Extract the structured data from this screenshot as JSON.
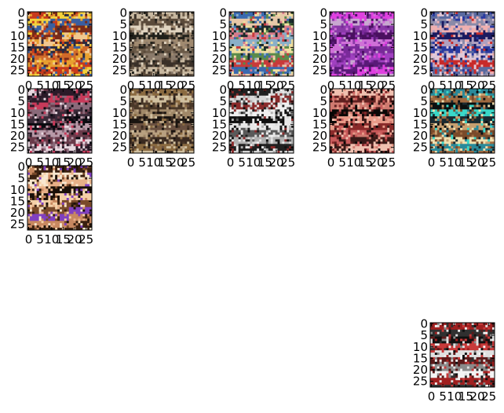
{
  "figure": {
    "panel_count": 12,
    "image_size": [
      28,
      28
    ],
    "axis": {
      "y_ticks": [
        "0",
        "5",
        "10",
        "15",
        "20",
        "25"
      ],
      "x_ticks": [
        "0",
        "5",
        "10",
        "15",
        "20",
        "25"
      ]
    },
    "panels": [
      {
        "name": "thumbnail-1",
        "palette": [
          "#e8a030",
          "#c83a1c",
          "#f4d23a",
          "#3a5fa0",
          "#7a2a18",
          "#f0c890",
          "#2a2a40",
          "#d06a2a"
        ]
      },
      {
        "name": "thumbnail-2",
        "palette": [
          "#8a7a6a",
          "#3a3028",
          "#c8b8a0",
          "#5a4a3a",
          "#e0d4c0",
          "#20201a",
          "#a08a70",
          "#6a5a48"
        ]
      },
      {
        "name": "thumbnail-3",
        "palette": [
          "#5a8a4a",
          "#c83a3a",
          "#3a6ab0",
          "#e8c8a8",
          "#1a2a2a",
          "#d87a8a",
          "#8ab0c8",
          "#f0e0a0"
        ]
      },
      {
        "name": "thumbnail-4",
        "palette": [
          "#7a2a9a",
          "#a040c0",
          "#5a1a78",
          "#e040e0",
          "#c8a8d0",
          "#8a3aa8",
          "#4a1060",
          "#d070d8"
        ]
      },
      {
        "name": "thumbnail-5",
        "palette": [
          "#2a3aa0",
          "#e0c8d8",
          "#c82a2a",
          "#5a6aa0",
          "#8a8aa8",
          "#f0b0b0",
          "#1a1a60",
          "#b0a0c0"
        ]
      },
      {
        "name": "thumbnail-6",
        "palette": [
          "#0a0a10",
          "#b89aa8",
          "#6a3a4a",
          "#e8d8e0",
          "#2a1a28",
          "#c83a5a",
          "#8a6a7a",
          "#3a2a38"
        ]
      },
      {
        "name": "thumbnail-7",
        "palette": [
          "#1a1410",
          "#6a5040",
          "#b8a080",
          "#3a2a20",
          "#8a6a40",
          "#d0c0a0",
          "#4a3828",
          "#a08868"
        ]
      },
      {
        "name": "thumbnail-8",
        "palette": [
          "#101010",
          "#e8e8e8",
          "#5a5a5a",
          "#b0b0b0",
          "#202020",
          "#d8d8d8",
          "#8a2a2a",
          "#f0f0f0"
        ]
      },
      {
        "name": "thumbnail-9",
        "palette": [
          "#0a0806",
          "#e89a88",
          "#8a2a2a",
          "#c85a5a",
          "#3a1a18",
          "#f0c0b0",
          "#602020",
          "#d07a70"
        ]
      },
      {
        "name": "thumbnail-10",
        "palette": [
          "#3ad8c8",
          "#1a2a30",
          "#c8a070",
          "#7a4a2a",
          "#f0e0b0",
          "#2a8a9a",
          "#a06a40",
          "#0a1010"
        ]
      },
      {
        "name": "thumbnail-11",
        "palette": [
          "#e8b088",
          "#1a1008",
          "#f4d0a8",
          "#7a4a2a",
          "#8040c0",
          "#c88860",
          "#3a2010",
          "#f8e8d0"
        ]
      },
      {
        "name": "thumbnail-12",
        "palette": [
          "#101010",
          "#c83a3a",
          "#e0e0e0",
          "#5a1a1a",
          "#8a8a8a",
          "#f4f4f4",
          "#a02020",
          "#303030"
        ]
      }
    ]
  }
}
